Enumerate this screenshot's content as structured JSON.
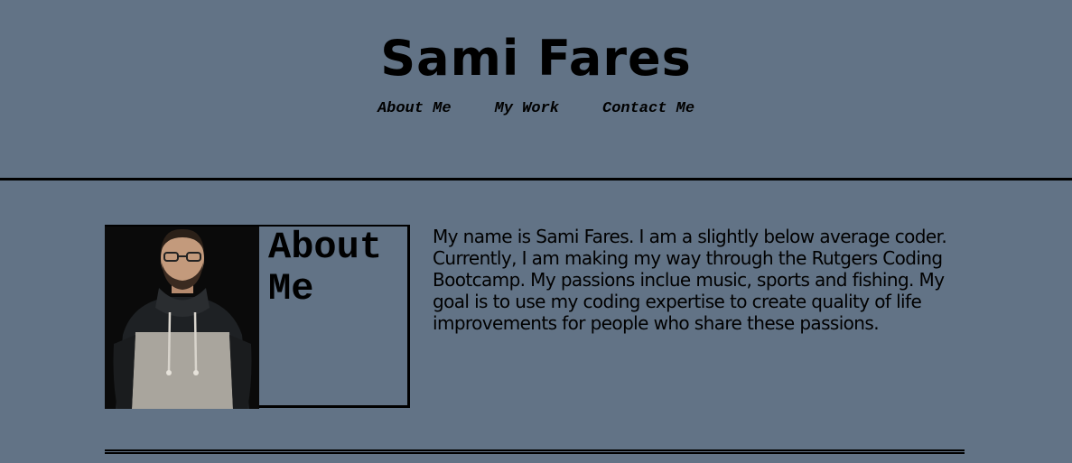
{
  "header": {
    "title": "Sami Fares",
    "nav": [
      {
        "label": "About Me"
      },
      {
        "label": "My Work"
      },
      {
        "label": "Contact Me"
      }
    ]
  },
  "about": {
    "heading": "About Me",
    "bio": "My name is Sami Fares. I am a slightly below average coder. Currently, I am making my way through the Rutgers Coding Bootcamp. My passions inclue music, sports and fishing. My goal is to use my coding expertise to create quality of life improvements for people who share these passions."
  },
  "colors": {
    "background": "#627386",
    "text": "#000000"
  }
}
